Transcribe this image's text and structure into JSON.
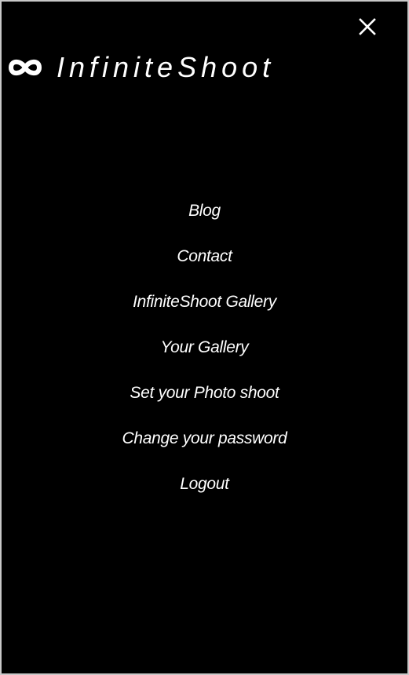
{
  "header": {
    "close_icon": "close-icon",
    "logo_icon": "infinity-icon",
    "brand_name": "InfiniteShoot"
  },
  "nav": {
    "items": [
      {
        "label": "Blog"
      },
      {
        "label": "Contact"
      },
      {
        "label": "InfiniteShoot Gallery"
      },
      {
        "label": "Your Gallery"
      },
      {
        "label": "Set your Photo shoot"
      },
      {
        "label": "Change your password"
      },
      {
        "label": "Logout"
      }
    ]
  },
  "colors": {
    "background": "#000000",
    "text": "#ffffff",
    "frame_border": "#c8c8c8"
  }
}
